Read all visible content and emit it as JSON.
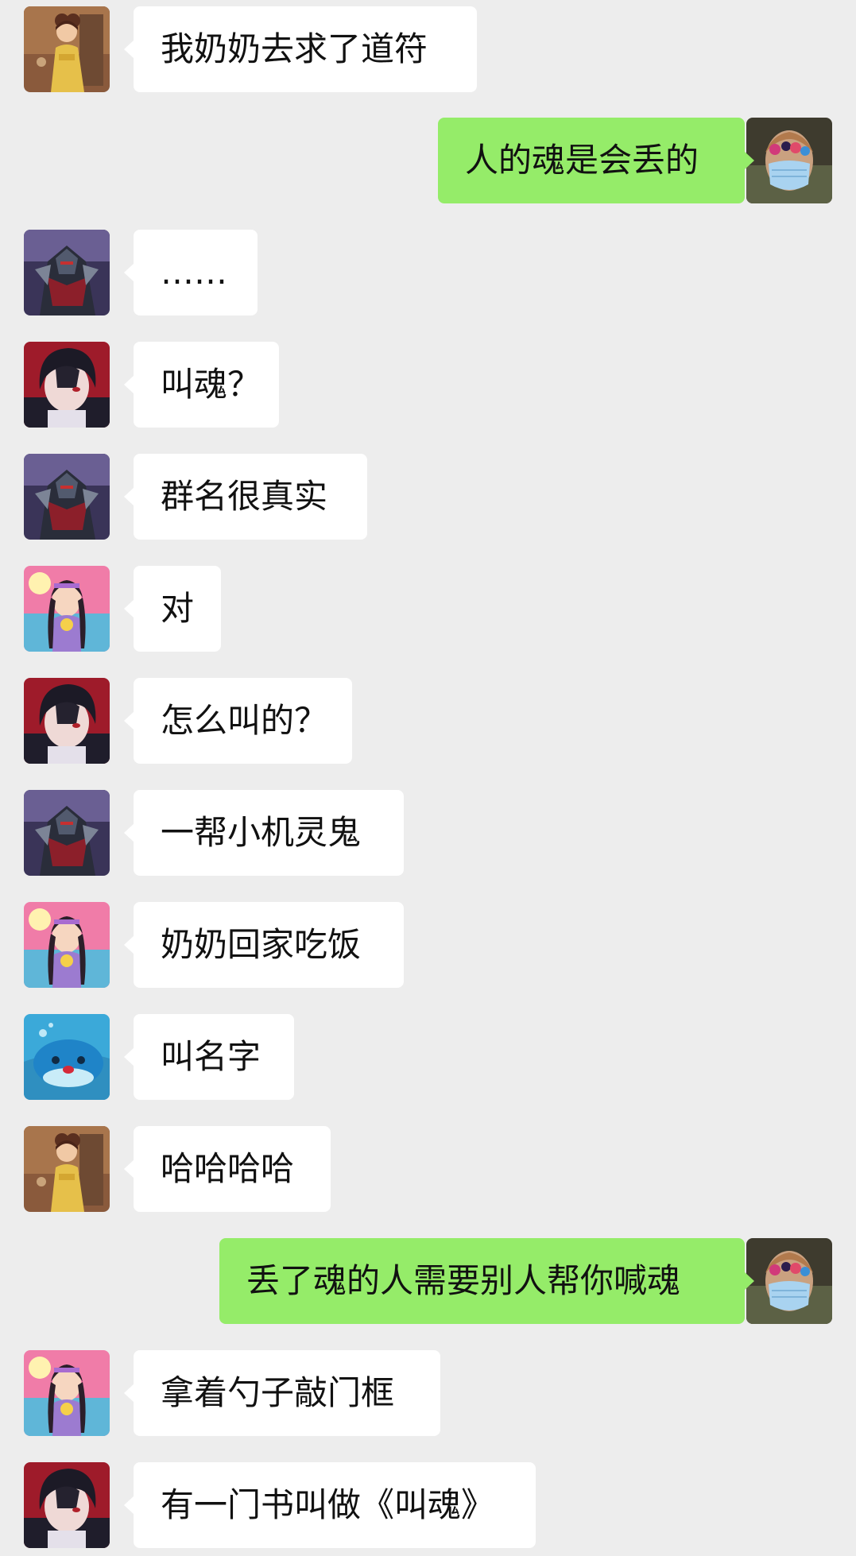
{
  "colors": {
    "background": "#ededed",
    "incoming_bubble": "#ffffff",
    "outgoing_bubble": "#95ec69",
    "text": "#111111"
  },
  "messages": [
    {
      "side": "left",
      "avatar": "avatar-golden-outfit-girl",
      "text": "我奶奶去求了道符"
    },
    {
      "side": "right",
      "avatar": "avatar-masked-portrait",
      "text": "人的魂是会丢的"
    },
    {
      "side": "left",
      "avatar": "avatar-armored-warrior",
      "text": "……"
    },
    {
      "side": "left",
      "avatar": "avatar-dark-hair-boy",
      "text": "叫魂？"
    },
    {
      "side": "left",
      "avatar": "avatar-armored-warrior",
      "text": "群名很真实"
    },
    {
      "side": "left",
      "avatar": "avatar-braided-girl",
      "text": "对"
    },
    {
      "side": "left",
      "avatar": "avatar-dark-hair-boy",
      "text": "怎么叫的？"
    },
    {
      "side": "left",
      "avatar": "avatar-armored-warrior",
      "text": "一帮小机灵鬼"
    },
    {
      "side": "left",
      "avatar": "avatar-braided-girl",
      "text": "奶奶回家吃饭"
    },
    {
      "side": "left",
      "avatar": "avatar-blue-whale",
      "text": "叫名字"
    },
    {
      "side": "left",
      "avatar": "avatar-golden-outfit-girl",
      "text": "哈哈哈哈"
    },
    {
      "side": "right",
      "avatar": "avatar-masked-portrait",
      "text": "丢了魂的人需要别人帮你喊魂"
    },
    {
      "side": "left",
      "avatar": "avatar-braided-girl",
      "text": "拿着勺子敲门框"
    },
    {
      "side": "left",
      "avatar": "avatar-dark-hair-boy",
      "text": "有一门书叫做《叫魂》"
    }
  ]
}
